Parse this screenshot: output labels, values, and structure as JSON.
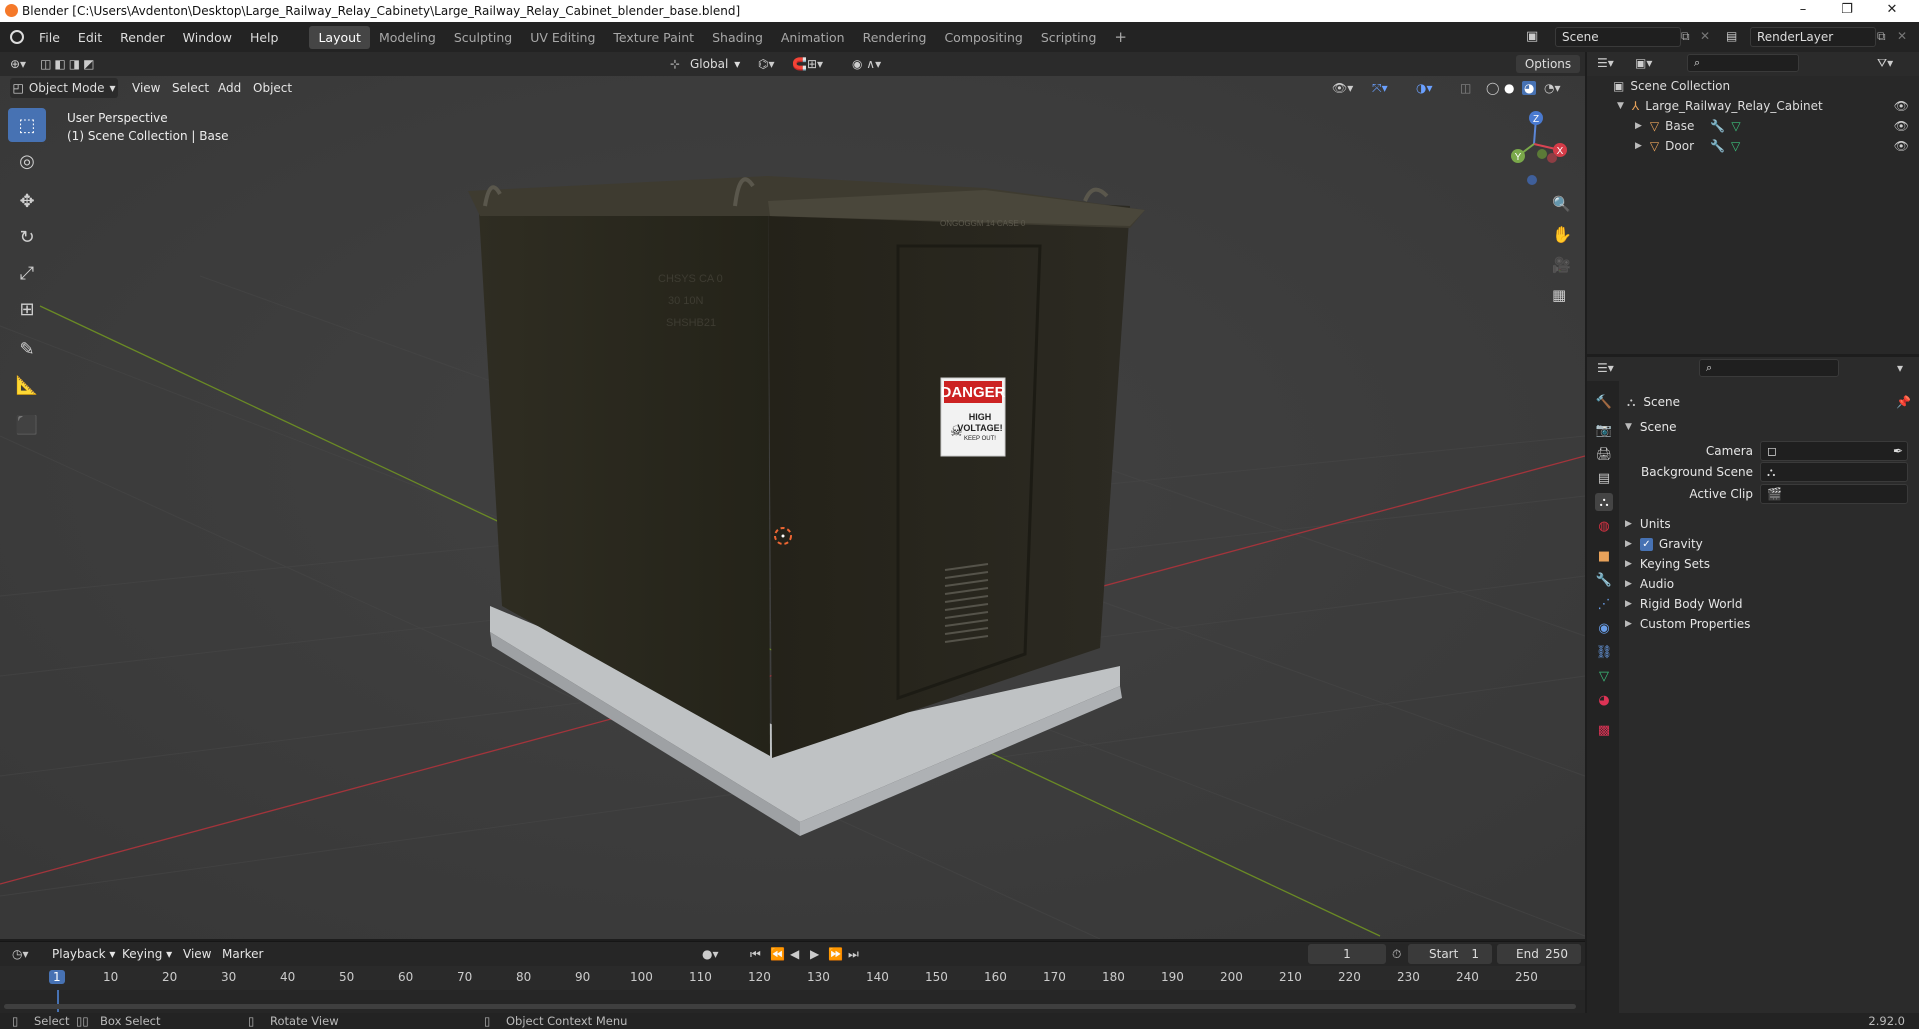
{
  "window": {
    "title": "Blender [C:\\Users\\Avdenton\\Desktop\\Large_Railway_Relay_Cabinety\\Large_Railway_Relay_Cabinet_blender_base.blend]",
    "minimize": "–",
    "maximize": "❐",
    "close": "✕"
  },
  "menu": [
    "File",
    "Edit",
    "Render",
    "Window",
    "Help"
  ],
  "workspaces": [
    "Layout",
    "Modeling",
    "Sculpting",
    "UV Editing",
    "Texture Paint",
    "Shading",
    "Animation",
    "Rendering",
    "Compositing",
    "Scripting"
  ],
  "workspace_add": "+",
  "scene_field": "Scene",
  "renderlayer_field": "RenderLayer",
  "viewport_header": {
    "mode": "Object Mode",
    "menus": [
      "View",
      "Select",
      "Add",
      "Object"
    ],
    "transform_orientation": "Global",
    "options": "Options"
  },
  "viewport_overlay": {
    "line1": "User Perspective",
    "line2": "(1) Scene Collection | Base"
  },
  "gizmo": {
    "x": "X",
    "y": "Y",
    "z": "Z"
  },
  "model_text": {
    "danger": "DANGER",
    "high": "HIGH",
    "voltage": "VOLTAGE!",
    "keep_out": "KEEP OUT!",
    "stencil1": "ONGOGGM  14 CASE 0",
    "stencil2": "CHSYS CA 0",
    "stencil3": "30 10N",
    "stencil4": "SHSHB21"
  },
  "outliner": {
    "root": "Scene Collection",
    "collection": "Large_Railway_Relay_Cabinet",
    "objects": [
      "Base",
      "Door"
    ]
  },
  "properties": {
    "context": "Scene",
    "panel": "Scene",
    "fields": [
      {
        "label": "Camera",
        "value": ""
      },
      {
        "label": "Background Scene",
        "value": ""
      },
      {
        "label": "Active Clip",
        "value": ""
      }
    ],
    "subpanels": [
      "Units",
      "Gravity",
      "Keying Sets",
      "Audio",
      "Rigid Body World",
      "Custom Properties"
    ],
    "gravity_checked": true
  },
  "timeline": {
    "menus": [
      "Playback",
      "Keying",
      "View",
      "Marker"
    ],
    "current_frame": "1",
    "start_label": "Start",
    "start": "1",
    "end_label": "End",
    "end": "250",
    "ruler": [
      "1",
      "10",
      "20",
      "30",
      "40",
      "50",
      "60",
      "70",
      "80",
      "90",
      "100",
      "110",
      "120",
      "130",
      "140",
      "150",
      "160",
      "170",
      "180",
      "190",
      "200",
      "210",
      "220",
      "230",
      "240",
      "250"
    ]
  },
  "status": {
    "select": "Select",
    "box_select": "Box Select",
    "rotate_view": "Rotate View",
    "context_menu": "Object Context Menu",
    "version": "2.92.0"
  }
}
